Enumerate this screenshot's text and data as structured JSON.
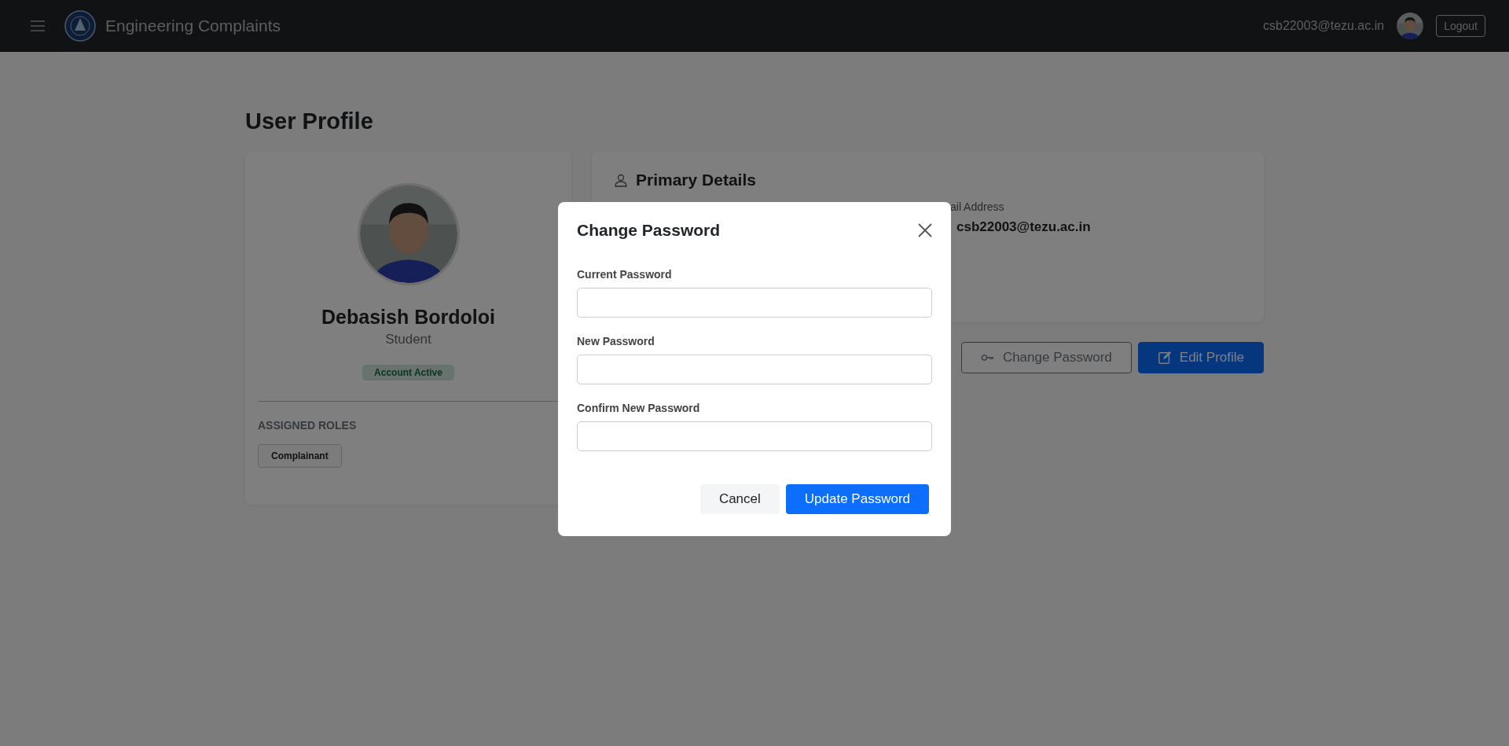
{
  "navbar": {
    "title": "Engineering Complaints",
    "user_email": "csb22003@tezu.ac.in",
    "logout": "Logout"
  },
  "page": {
    "title": "User Profile"
  },
  "profile_card": {
    "name": "Debasish Bordoloi",
    "role": "Student",
    "status": "Account Active",
    "roles_heading": "ASSIGNED ROLES",
    "roles": [
      "Complainant"
    ]
  },
  "details_card": {
    "title": "Primary Details",
    "fields": [
      {
        "label": "ail Address",
        "value": "csb22003@tezu.ac.in"
      }
    ]
  },
  "actions": [
    {
      "kind": "outline",
      "label": "Change Password"
    },
    {
      "kind": "primary",
      "label": "Edit Profile"
    }
  ],
  "modal": {
    "title": "Change Password",
    "fields": [
      {
        "label": "Current Password"
      },
      {
        "label": "New Password"
      },
      {
        "label": "Confirm New Password"
      }
    ],
    "buttons": [
      {
        "kind": "secondary",
        "label": "Cancel"
      },
      {
        "kind": "primary",
        "label": "Update Password"
      }
    ]
  }
}
